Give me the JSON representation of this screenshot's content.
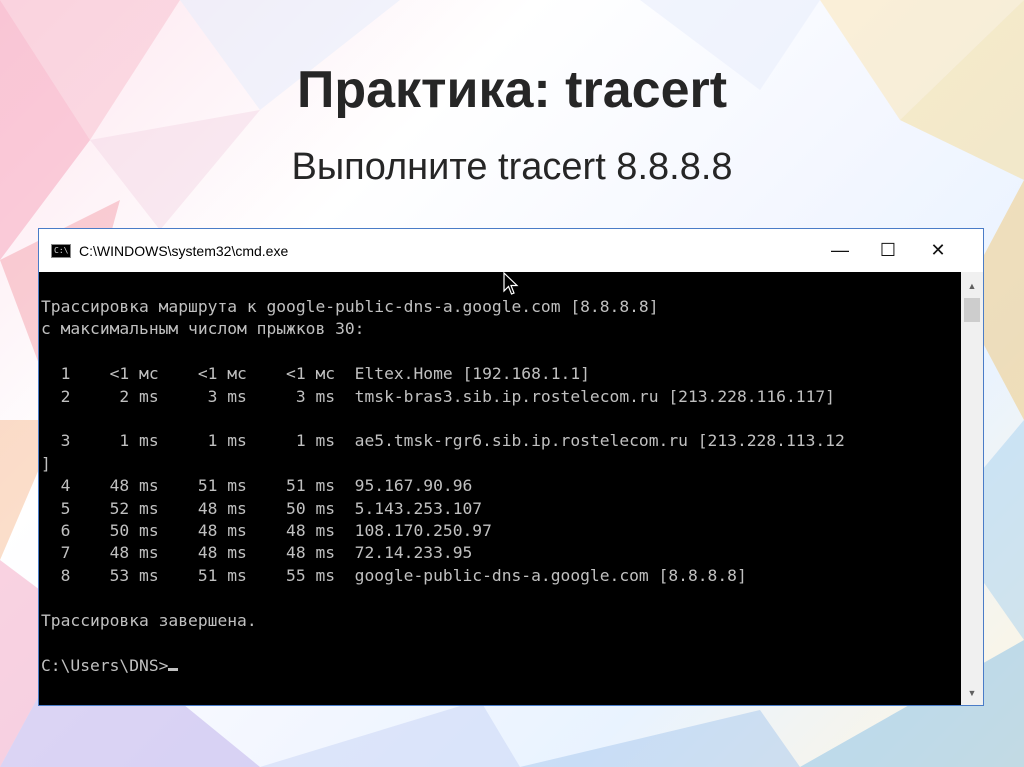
{
  "slide": {
    "title": "Практика: tracert",
    "subtitle": "Выполните tracert 8.8.8.8"
  },
  "window": {
    "title": "C:\\WINDOWS\\system32\\cmd.exe",
    "icon_text": "C:\\",
    "controls": {
      "minimize": "—",
      "maximize": "☐",
      "close": "✕"
    }
  },
  "terminal": {
    "lines": [
      "Трассировка маршрута к google-public-dns-a.google.com [8.8.8.8]",
      "с максимальным числом прыжков 30:",
      "",
      "  1    <1 мс    <1 мс    <1 мс  Eltex.Home [192.168.1.1]",
      "  2     2 ms     3 ms     3 ms  tmsk-bras3.sib.ip.rostelecom.ru [213.228.116.117]",
      "",
      "  3     1 ms     1 ms     1 ms  ae5.tmsk-rgr6.sib.ip.rostelecom.ru [213.228.113.12",
      "]",
      "  4    48 ms    51 ms    51 ms  95.167.90.96",
      "  5    52 ms    48 ms    50 ms  5.143.253.107",
      "  6    50 ms    48 ms    48 ms  108.170.250.97",
      "  7    48 ms    48 ms    48 ms  72.14.233.95",
      "  8    53 ms    51 ms    55 ms  google-public-dns-a.google.com [8.8.8.8]",
      "",
      "Трассировка завершена.",
      ""
    ],
    "prompt": "C:\\Users\\DNS>"
  },
  "colors": {
    "terminal_bg": "#000000",
    "terminal_fg": "#c0c0c0",
    "window_border": "#4a7cc7"
  },
  "icons": {
    "cmd": "cmd-icon",
    "cursor": "mouse-pointer-icon"
  }
}
